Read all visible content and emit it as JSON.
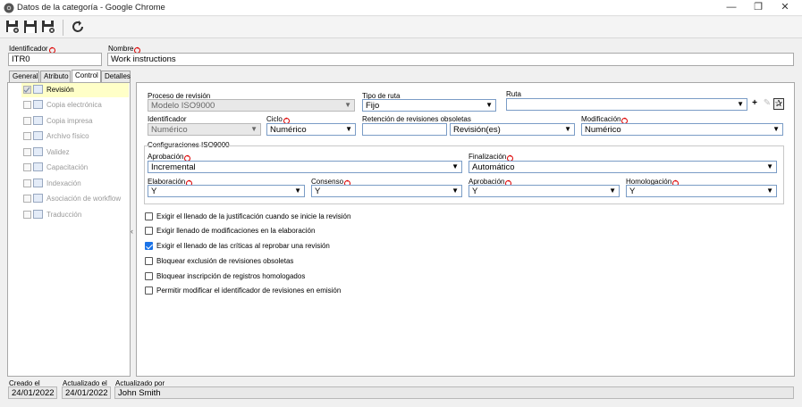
{
  "window": {
    "title": "Datos de la categoría - Google Chrome"
  },
  "header": {
    "identificador_label": "Identificador",
    "identificador_value": "ITR0",
    "nombre_label": "Nombre",
    "nombre_value": "Work instructions"
  },
  "tabs": [
    {
      "label": "General"
    },
    {
      "label": "Atributo"
    },
    {
      "label": "Control"
    },
    {
      "label": "Detalles"
    }
  ],
  "tree": [
    {
      "label": "Revisión"
    },
    {
      "label": "Copia electrónica"
    },
    {
      "label": "Copia impresa"
    },
    {
      "label": "Archivo físico"
    },
    {
      "label": "Validez"
    },
    {
      "label": "Capacitación"
    },
    {
      "label": "Indexación"
    },
    {
      "label": "Asociación de workflow"
    },
    {
      "label": "Traducción"
    }
  ],
  "form": {
    "proceso_label": "Proceso de revisión",
    "proceso_value": "Modelo ISO9000",
    "tipo_ruta_label": "Tipo de ruta",
    "tipo_ruta_value": "Fijo",
    "ruta_label": "Ruta",
    "ruta_value": "",
    "identificador_label": "Identificador",
    "identificador_value": "Numérico",
    "ciclo_label": "Ciclo",
    "ciclo_value": "Numérico",
    "retencion_label": "Retención de revisiones obsoletas",
    "retencion_num": "",
    "retencion_unit": "Revisión(es)",
    "modificacion_label": "Modificación",
    "modificacion_value": "Numérico",
    "iso_group_label": "Configuraciones ISO9000",
    "aprobacion_label": "Aprobación",
    "aprobacion_value": "Incremental",
    "finalizacion_label": "Finalización",
    "finalizacion_value": "Automático",
    "elaboracion_label": "Elaboración",
    "elaboracion_value": "Y",
    "consenso_label": "Consenso",
    "consenso_value": "Y",
    "aprobacion2_label": "Aprobación",
    "aprobacion2_value": "Y",
    "homologacion_label": "Homologación",
    "homologacion_value": "Y"
  },
  "checks": [
    {
      "label": "Exigir el llenado de la justificación cuando se inicie la revisión",
      "checked": false
    },
    {
      "label": "Exigir llenado de modificaciones en la elaboración",
      "checked": false
    },
    {
      "label": "Exigir el llenado de las críticas al reprobar una revisión",
      "checked": true
    },
    {
      "label": "Bloquear exclusión de revisiones obsoletas",
      "checked": false
    },
    {
      "label": "Bloquear inscripción de registros homologados",
      "checked": false
    },
    {
      "label": "Permitir modificar el identificador de revisiones en emisión",
      "checked": false
    }
  ],
  "footer": {
    "creado_label": "Creado el",
    "creado_value": "24/01/2022",
    "actualizado_label": "Actualizado el",
    "actualizado_value": "24/01/2022",
    "actualizado_por_label": "Actualizado por",
    "actualizado_por_value": "John Smith"
  },
  "colors": {
    "accent": "#1a73e8",
    "required": "#dd0000",
    "selected_row": "#ffffc8"
  }
}
